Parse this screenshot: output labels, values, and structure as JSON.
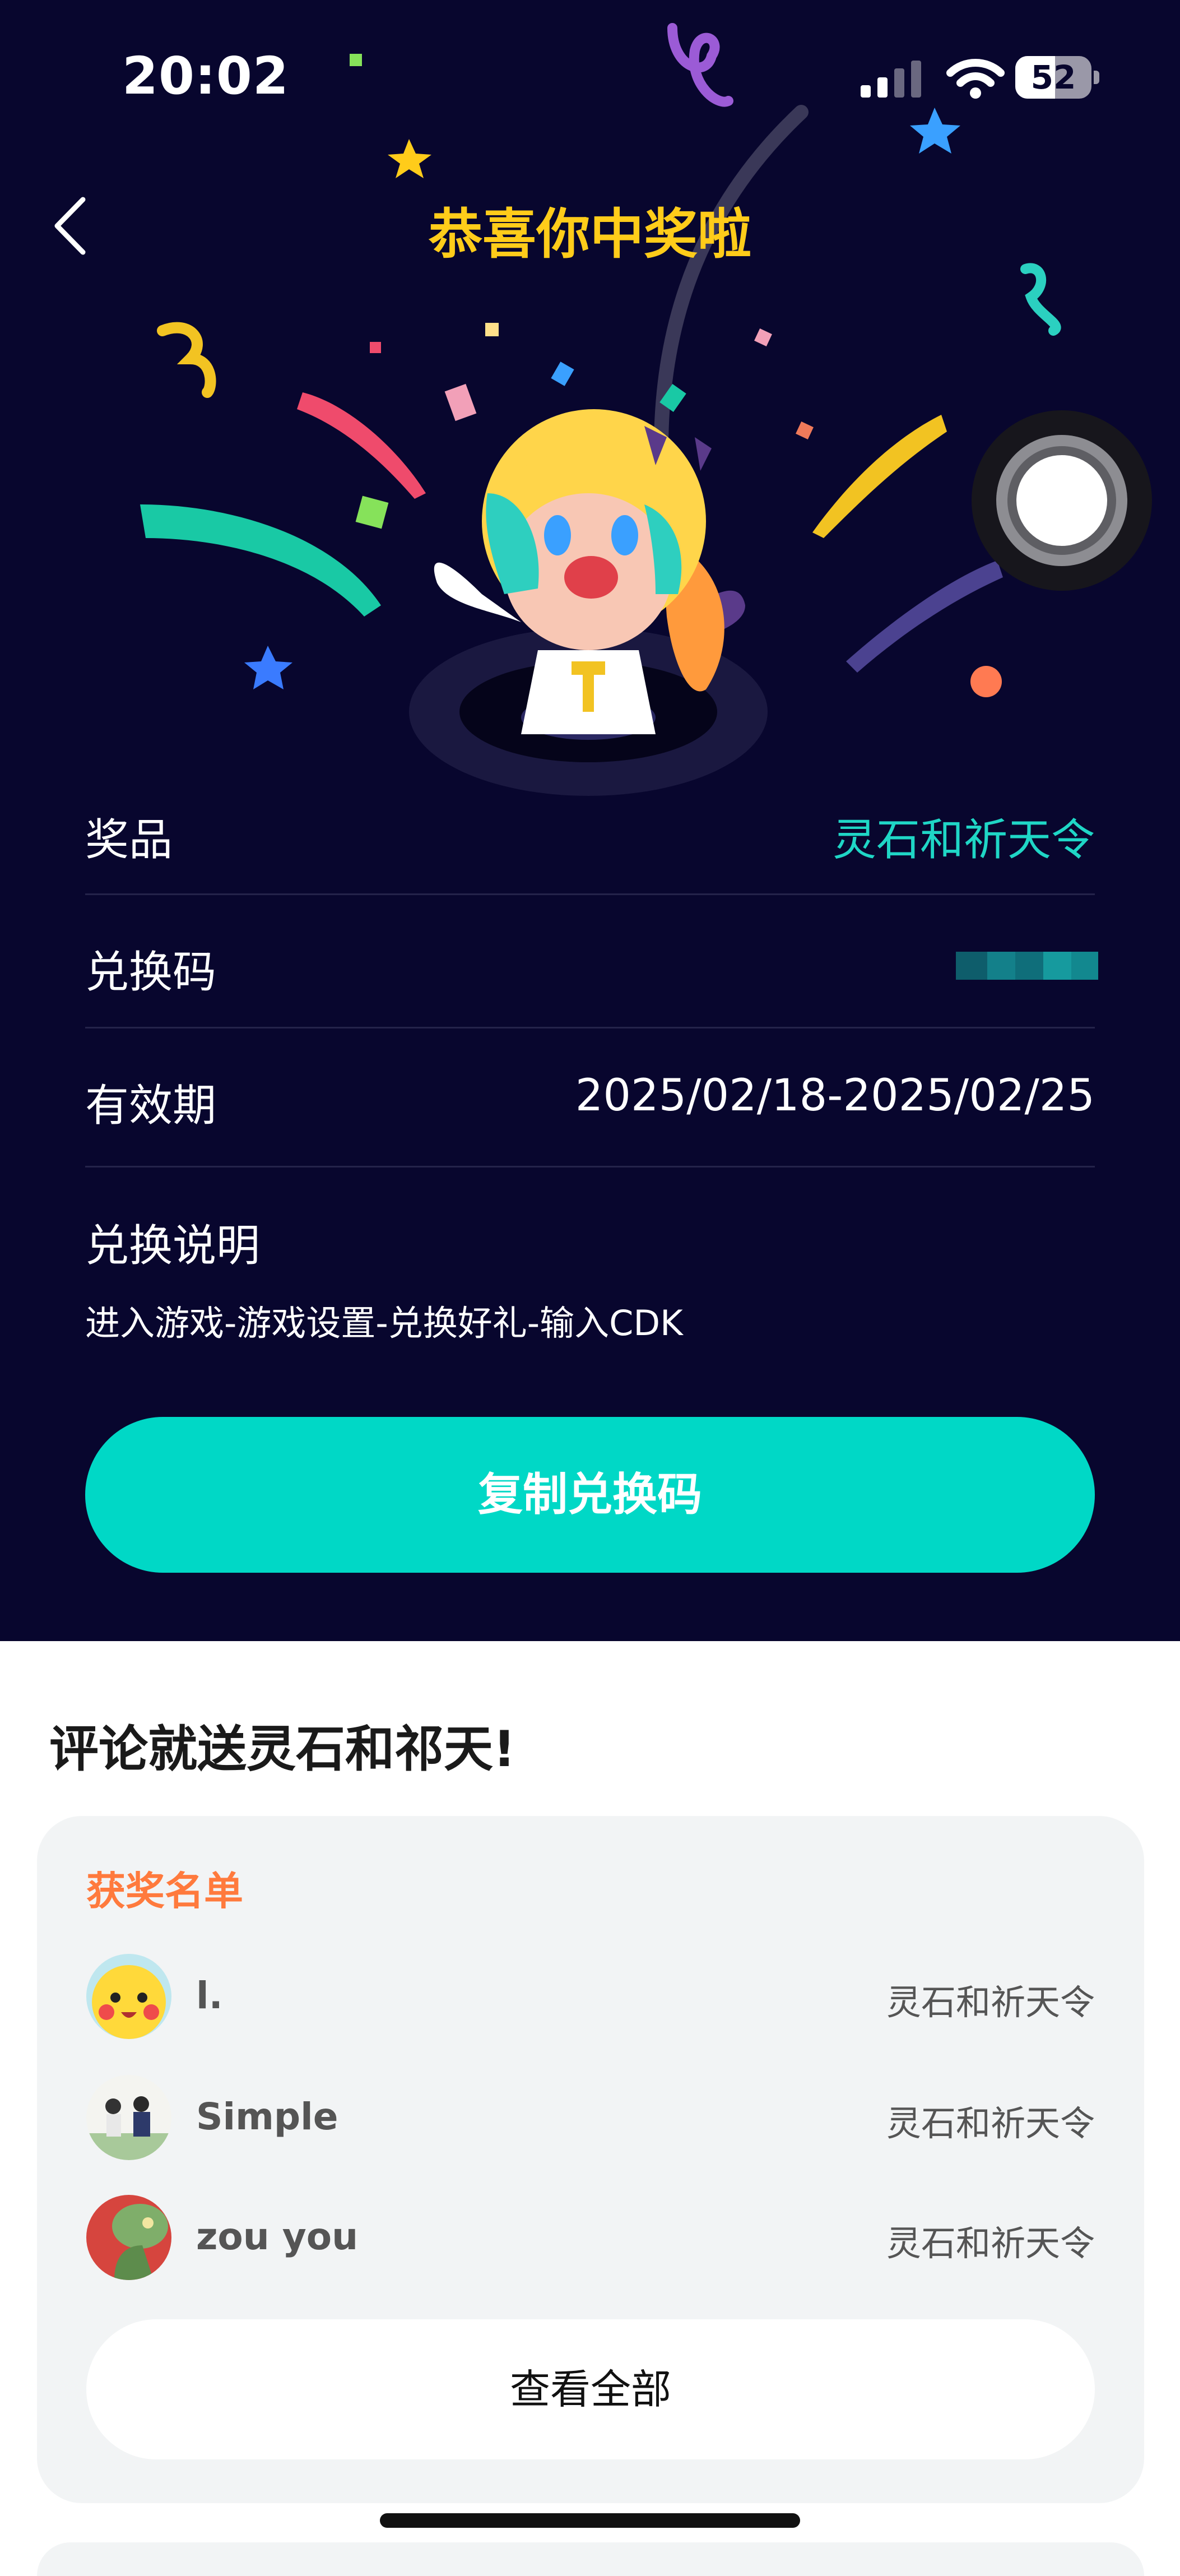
{
  "status_bar": {
    "time": "20:02",
    "battery": "52",
    "battery_level": 0.52,
    "icons": [
      "cellular-signal-icon",
      "wifi-icon",
      "battery-icon"
    ]
  },
  "header": {
    "title": "恭喜你中奖啦",
    "back_icon": "chevron-left-icon"
  },
  "prize_info": {
    "prize_label": "奖品",
    "prize_value": "灵石和祈天令",
    "code_label": "兑换码",
    "validity_label": "有效期",
    "validity_value": "2025/02/18-2025/02/25",
    "instructions_label": "兑换说明",
    "instructions_text": "进入游戏-游戏设置-兑换好礼-输入CDK"
  },
  "copy_button": {
    "label": "复制兑换码"
  },
  "comment_section": {
    "title": "评论就送灵石和祁天!",
    "winners_title": "获奖名单",
    "winners": [
      {
        "name": "l.",
        "prize": "灵石和祈天令"
      },
      {
        "name": "Simple",
        "prize": "灵石和祈天令"
      },
      {
        "name": "zou you",
        "prize": "灵石和祈天令"
      }
    ],
    "view_all_label": "查看全部"
  },
  "colors": {
    "hero_background": "#08062e",
    "title_yellow": "#ffcc1a",
    "accent_teal": "#00d8c6",
    "prize_teal": "#1fd6c6",
    "winners_orange": "#ff7a3d"
  }
}
